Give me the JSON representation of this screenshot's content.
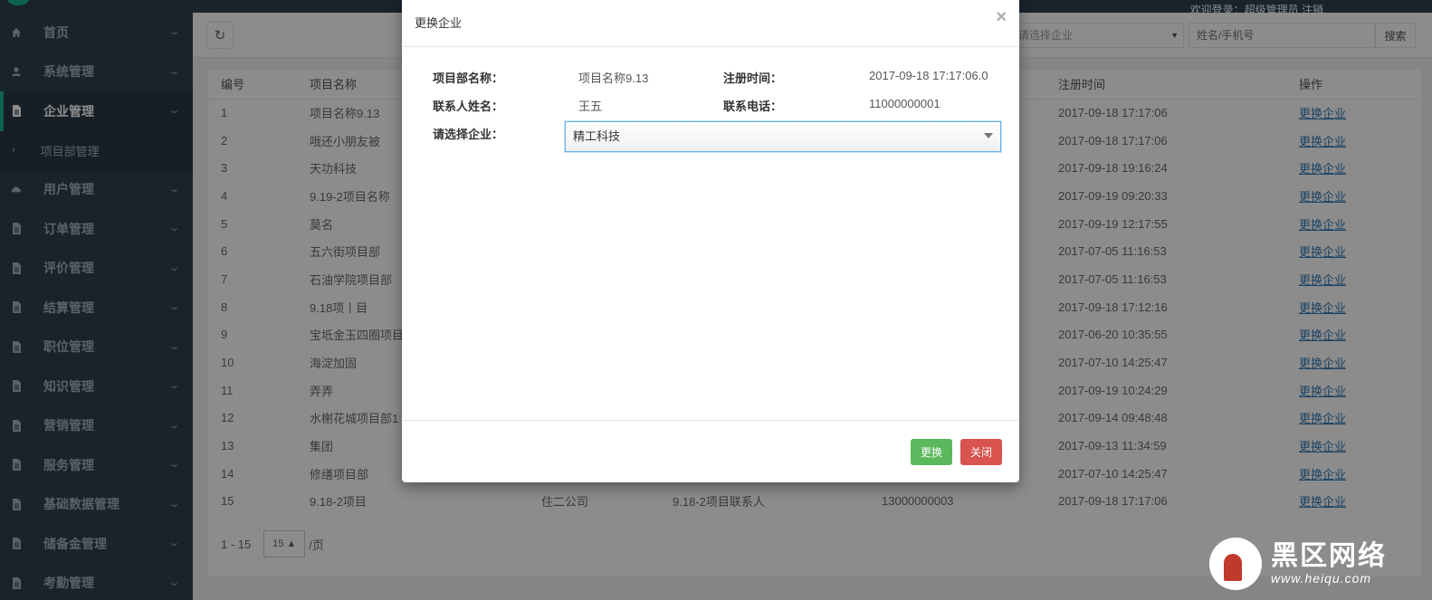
{
  "header": {
    "welcome_text": "欢迎登录：超级管理员 注销"
  },
  "sidebar": {
    "items": [
      {
        "label": "首页",
        "icon": "home-icon"
      },
      {
        "label": "系统管理",
        "icon": "user-icon"
      },
      {
        "label": "企业管理",
        "icon": "file-icon"
      },
      {
        "label": "用户管理",
        "icon": "cloud-icon"
      },
      {
        "label": "订单管理",
        "icon": "file-icon"
      },
      {
        "label": "评价管理",
        "icon": "file-icon"
      },
      {
        "label": "结算管理",
        "icon": "file-icon"
      },
      {
        "label": "职位管理",
        "icon": "file-icon"
      },
      {
        "label": "知识管理",
        "icon": "file-icon"
      },
      {
        "label": "营销管理",
        "icon": "file-icon"
      },
      {
        "label": "服务管理",
        "icon": "file-icon"
      },
      {
        "label": "基础数据管理",
        "icon": "file-icon"
      },
      {
        "label": "储备金管理",
        "icon": "file-icon"
      },
      {
        "label": "考勤管理",
        "icon": "file-icon"
      }
    ],
    "sub_item": {
      "label": "项目部管理"
    }
  },
  "toolbar": {
    "company_select": "请选择企业",
    "search_placeholder": "姓名/手机号",
    "search_label": "搜索"
  },
  "table": {
    "headers": [
      "编号",
      "项目名称",
      "",
      "",
      "",
      "注册时间",
      "操作"
    ],
    "rows": [
      {
        "id": "1",
        "name": "项目名称9.13",
        "company": "",
        "contact": "",
        "phone": "",
        "time": "2017-09-18 17:17:06",
        "op": "更换企业"
      },
      {
        "id": "2",
        "name": "哦还小朋友被",
        "company": "",
        "contact": "",
        "phone": "",
        "time": "2017-09-18 17:17:06",
        "op": "更换企业"
      },
      {
        "id": "3",
        "name": "天功科技",
        "company": "",
        "contact": "",
        "phone": "",
        "time": "2017-09-18 19:16:24",
        "op": "更换企业"
      },
      {
        "id": "4",
        "name": "9.19-2项目名称",
        "company": "",
        "contact": "",
        "phone": "",
        "time": "2017-09-19 09:20:33",
        "op": "更换企业"
      },
      {
        "id": "5",
        "name": "莫名",
        "company": "",
        "contact": "",
        "phone": "",
        "time": "2017-09-19 12:17:55",
        "op": "更换企业"
      },
      {
        "id": "6",
        "name": "五六街项目部",
        "company": "",
        "contact": "",
        "phone": "",
        "time": "2017-07-05 11:16:53",
        "op": "更换企业"
      },
      {
        "id": "7",
        "name": "石油学院项目部",
        "company": "",
        "contact": "",
        "phone": "",
        "time": "2017-07-05 11:16:53",
        "op": "更换企业"
      },
      {
        "id": "8",
        "name": "9.18项丨目",
        "company": "",
        "contact": "",
        "phone": "",
        "time": "2017-09-18 17:12:16",
        "op": "更换企业"
      },
      {
        "id": "9",
        "name": "宝坻金玉四圈项目",
        "company": "",
        "contact": "",
        "phone": "",
        "time": "2017-06-20 10:35:55",
        "op": "更换企业"
      },
      {
        "id": "10",
        "name": "海淀加固",
        "company": "",
        "contact": "",
        "phone": "",
        "time": "2017-07-10 14:25:47",
        "op": "更换企业"
      },
      {
        "id": "11",
        "name": "弄弄",
        "company": "",
        "contact": "",
        "phone": "",
        "time": "2017-09-19 10:24:29",
        "op": "更换企业"
      },
      {
        "id": "12",
        "name": "水榭花城项目部1",
        "company": "",
        "contact": "",
        "phone": "",
        "time": "2017-09-14 09:48:48",
        "op": "更换企业"
      },
      {
        "id": "13",
        "name": "集团",
        "company": "",
        "contact": "",
        "phone": "",
        "time": "2017-09-13 11:34:59",
        "op": "更换企业"
      },
      {
        "id": "14",
        "name": "修缮项目部",
        "company": "",
        "contact": "",
        "phone": "",
        "time": "2017-07-10 14:25:47",
        "op": "更换企业"
      },
      {
        "id": "15",
        "name": "9.18-2项目",
        "company": "住二公司",
        "contact": "9.18-2项目联系人",
        "phone": "13000000003",
        "time": "2017-09-18 17:17:06",
        "op": "更换企业"
      }
    ]
  },
  "pager": {
    "range": "1 - 15",
    "size": "15",
    "per_page": "/页"
  },
  "modal": {
    "title": "更换企业",
    "close_symbol": "×",
    "project_label": "项目部名称：",
    "project_value": "项目名称9.13",
    "reg_time_label": "注册时间：",
    "reg_time_value": "2017-09-18 17:17:06.0",
    "contact_label": "联系人姓名：",
    "contact_value": "王五",
    "phone_label": "联系电话：",
    "phone_value": "11000000001",
    "company_label": "请选择企业：",
    "company_value": "精工科技",
    "change_button": "更换",
    "close_button": "关闭"
  },
  "watermark": {
    "main": "黑区网络",
    "sub": "www.heiqu.com"
  }
}
